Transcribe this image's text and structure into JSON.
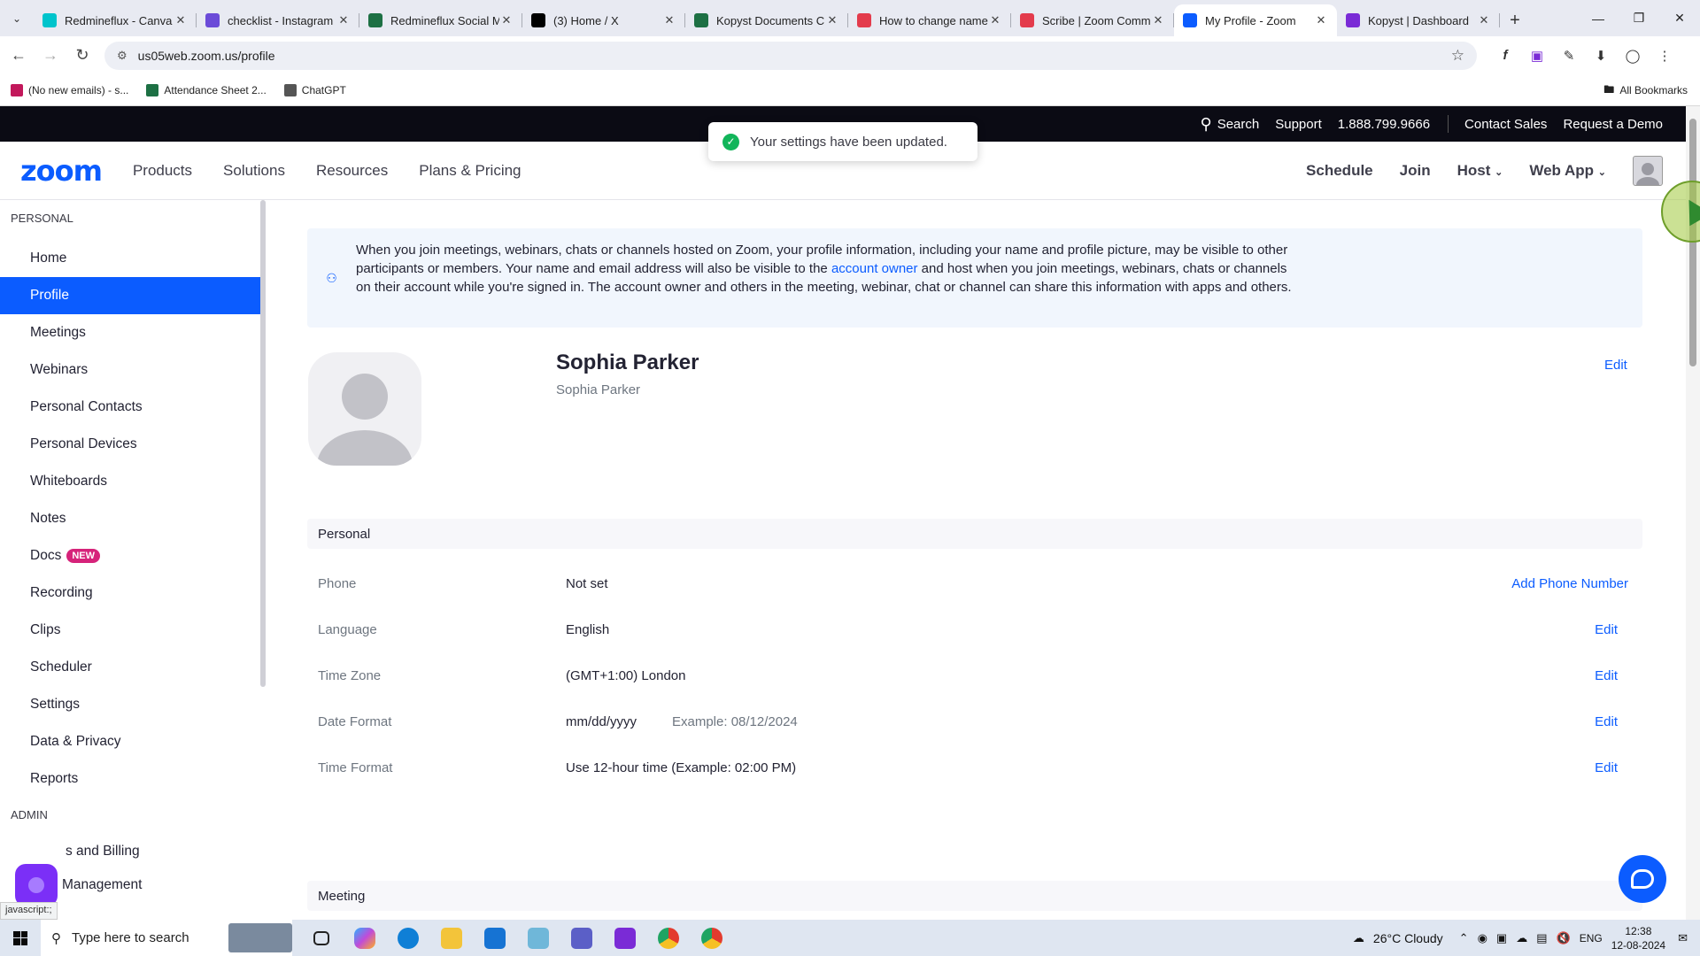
{
  "browser": {
    "tabs": [
      {
        "label": "Redmineflux - Canva",
        "icon_color": "#00c4cc",
        "active": false
      },
      {
        "label": "checklist - Instagram",
        "icon_color": "#6b4bd8",
        "active": false
      },
      {
        "label": "Redmineflux Social M",
        "icon_color": "#1d7044",
        "active": false
      },
      {
        "label": "(3) Home / X",
        "icon_color": "#000000",
        "active": false
      },
      {
        "label": "Kopyst Documents Cr",
        "icon_color": "#1d7044",
        "active": false
      },
      {
        "label": "How to change name",
        "icon_color": "#e33b4c",
        "active": false
      },
      {
        "label": "Scribe | Zoom Comm",
        "icon_color": "#e33b4c",
        "active": false
      },
      {
        "label": "My Profile - Zoom",
        "icon_color": "#0b5cff",
        "active": true
      },
      {
        "label": "Kopyst | Dashboard",
        "icon_color": "#7a2bd6",
        "active": false
      }
    ],
    "url": "us05web.zoom.us/profile",
    "bookmarks": [
      {
        "label": "(No new emails) - s...",
        "icon_color": "#c2185b"
      },
      {
        "label": "Attendance Sheet 2...",
        "icon_color": "#1d7044"
      },
      {
        "label": "ChatGPT",
        "icon_color": "#555555"
      }
    ],
    "all_bookmarks": "All Bookmarks"
  },
  "zoom_topbar": {
    "search": "Search",
    "support": "Support",
    "phone": "1.888.799.9666",
    "contact_sales": "Contact Sales",
    "request_demo": "Request a Demo"
  },
  "zoom_nav": {
    "logo": "zoom",
    "menu": [
      "Products",
      "Solutions",
      "Resources",
      "Plans & Pricing"
    ],
    "schedule": "Schedule",
    "join": "Join",
    "host": "Host",
    "web_app": "Web App"
  },
  "toast": {
    "message": "Your settings have been updated."
  },
  "sidebar": {
    "personal_header": "PERSONAL",
    "items": [
      {
        "label": "Home",
        "active": false
      },
      {
        "label": "Profile",
        "active": true
      },
      {
        "label": "Meetings",
        "active": false
      },
      {
        "label": "Webinars",
        "active": false
      },
      {
        "label": "Personal Contacts",
        "active": false
      },
      {
        "label": "Personal Devices",
        "active": false
      },
      {
        "label": "Whiteboards",
        "active": false
      },
      {
        "label": "Notes",
        "active": false
      },
      {
        "label": "Docs",
        "active": false,
        "badge": "NEW"
      },
      {
        "label": "Recording",
        "active": false
      },
      {
        "label": "Clips",
        "active": false
      },
      {
        "label": "Scheduler",
        "active": false
      },
      {
        "label": "Settings",
        "active": false
      },
      {
        "label": "Data & Privacy",
        "active": false
      },
      {
        "label": "Reports",
        "active": false
      }
    ],
    "admin_header": "ADMIN",
    "admin_items": [
      "s and Billing",
      "Management"
    ]
  },
  "notice": {
    "text_before": "When you join meetings, webinars, chats or channels hosted on Zoom, your profile information, including your name and profile picture, may be visible to other participants or members. Your name and email address will also be visible to the ",
    "link": "account owner",
    "text_after": " and host when you join meetings, webinars, chats or channels on their account while you're signed in. The account owner and others in the meeting, webinar, chat or channel can share this information with apps and others."
  },
  "profile": {
    "name": "Sophia Parker",
    "display_name": "Sophia Parker",
    "edit": "Edit"
  },
  "personal_section": {
    "title": "Personal",
    "rows": [
      {
        "label": "Phone",
        "value": "Not set",
        "extra": "",
        "action": "Add Phone Number"
      },
      {
        "label": "Language",
        "value": "English",
        "extra": "",
        "action": "Edit"
      },
      {
        "label": "Time Zone",
        "value": "(GMT+1:00) London",
        "extra": "",
        "action": "Edit"
      },
      {
        "label": "Date Format",
        "value": "mm/dd/yyyy",
        "extra": "Example: 08/12/2024",
        "action": "Edit"
      },
      {
        "label": "Time Format",
        "value": "Use 12-hour time (Example: 02:00 PM)",
        "extra": "",
        "action": "Edit"
      }
    ]
  },
  "meeting_section": {
    "title": "Meeting"
  },
  "status_url": "javascript:;",
  "taskbar": {
    "search_placeholder": "Type here to search",
    "weather": "26°C  Cloudy",
    "lang": "ENG",
    "time": "12:38",
    "date": "12-08-2024"
  },
  "colors": {
    "accent": "#0b5cff",
    "badge": "#d6237a",
    "success": "#12b55a"
  }
}
